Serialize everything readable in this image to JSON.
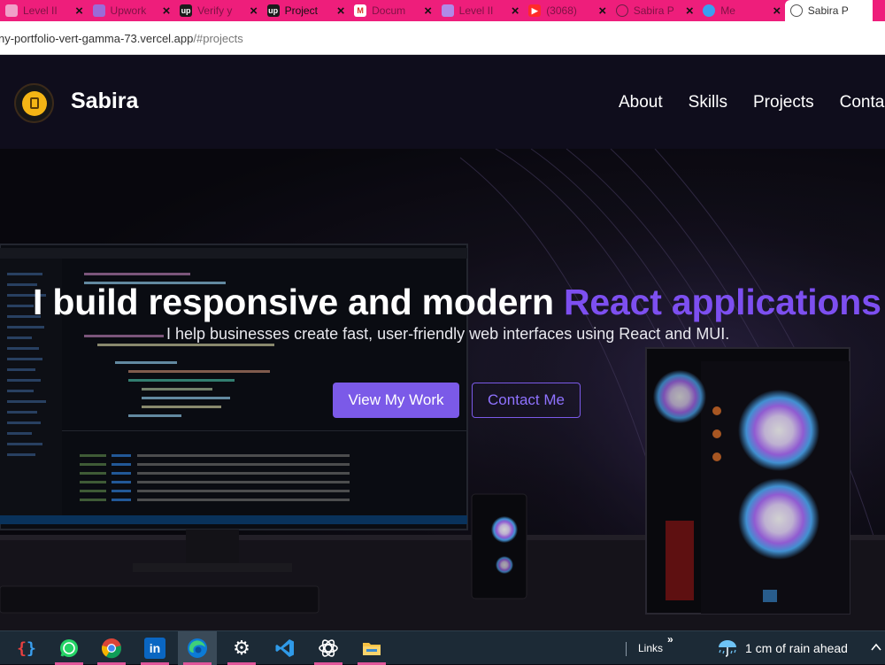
{
  "browser": {
    "tabs": [
      {
        "title": "Level II",
        "icon": "document-icon",
        "color": "#f0a0c8"
      },
      {
        "title": "Upwork",
        "icon": "upwork-icon",
        "color": "#9c6bd8"
      },
      {
        "title": "Verify y",
        "icon": "upwork-icon",
        "color": "#222222"
      },
      {
        "title": "Project",
        "icon": "upwork-icon",
        "color": "#222222"
      },
      {
        "title": "Docum",
        "icon": "gmail-icon",
        "color": "#ffffff"
      },
      {
        "title": "Level II",
        "icon": "document-icon",
        "color": "#b08ae8"
      },
      {
        "title": "(3068)",
        "icon": "youtube-icon",
        "color": "#ff2a2a"
      },
      {
        "title": "Sabira P",
        "icon": "globe-icon",
        "color": "#f5a0c8"
      },
      {
        "title": "Me",
        "icon": "apps-icon",
        "color": "#3aa0f0"
      },
      {
        "title": "Sabira P",
        "icon": "globe-icon",
        "color": "#666666"
      }
    ],
    "active_tab_index": 9,
    "address": {
      "host": "ny-portfolio-vert-gamma-73.vercel.app",
      "path": "/#projects"
    }
  },
  "site": {
    "brand": "Sabira",
    "nav": [
      "About",
      "Skills",
      "Projects",
      "Contact"
    ],
    "hero": {
      "heading_plain": "I build responsive and modern ",
      "heading_accent": "React applications",
      "subheading": "I help businesses create fast, user-friendly web interfaces using React and MUI.",
      "primary_button": "View My Work",
      "secondary_button": "Contact Me"
    },
    "colors": {
      "accent": "#7b5ae8",
      "header_bg": "#0f0d1c"
    }
  },
  "taskbar": {
    "apps": [
      {
        "name": "dev-tools-icon"
      },
      {
        "name": "whatsapp-icon"
      },
      {
        "name": "chrome-icon"
      },
      {
        "name": "linkedin-icon"
      },
      {
        "name": "edge-icon",
        "active": true
      },
      {
        "name": "settings-icon"
      },
      {
        "name": "vscode-icon"
      },
      {
        "name": "chatgpt-icon"
      },
      {
        "name": "file-explorer-icon"
      }
    ],
    "links_label": "Links",
    "chevron": "»",
    "weather": "1 cm of rain ahead"
  }
}
